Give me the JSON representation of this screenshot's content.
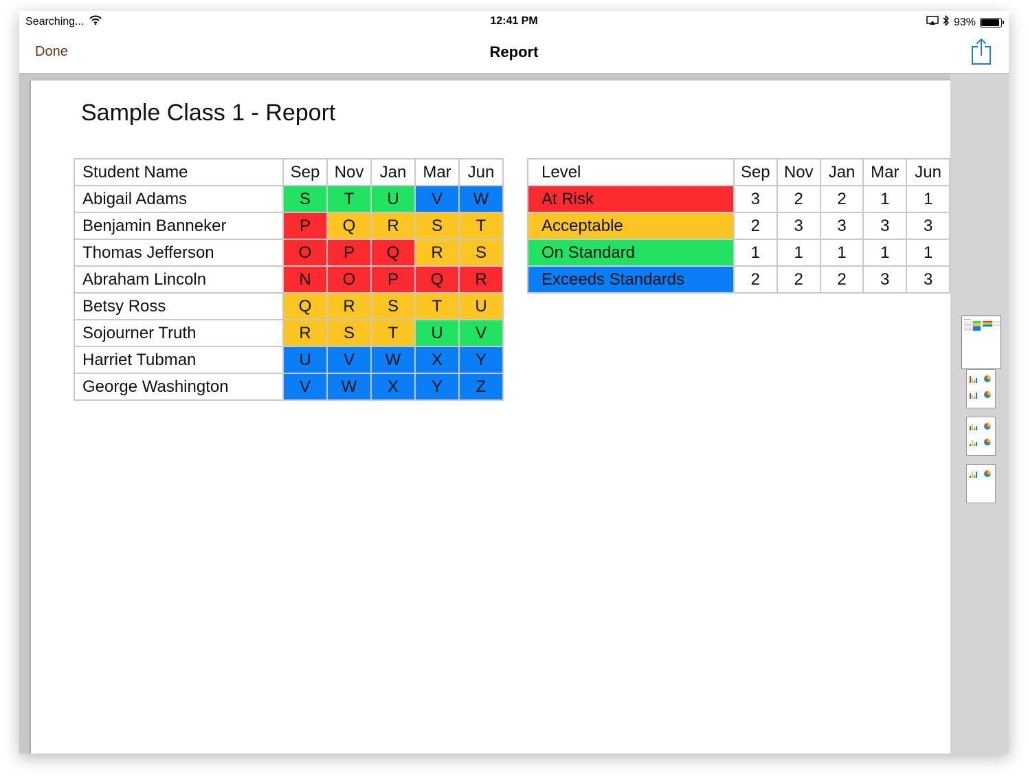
{
  "status_bar": {
    "carrier": "Searching...",
    "time": "12:41 PM",
    "battery": "93%",
    "battery_level": 0.93
  },
  "nav": {
    "done_label": "Done",
    "title": "Report"
  },
  "report": {
    "title": "Sample Class 1 - Report",
    "months": [
      "Sep",
      "Nov",
      "Jan",
      "Mar",
      "Jun"
    ],
    "students_header": "Student Name",
    "students": [
      {
        "name": "Abigail Adams",
        "grades": [
          "S",
          "T",
          "U",
          "V",
          "W"
        ],
        "colors": [
          "#22e261",
          "#22e261",
          "#22e261",
          "#0a7ef7",
          "#0a7ef7"
        ]
      },
      {
        "name": "Benjamin Banneker",
        "grades": [
          "P",
          "Q",
          "R",
          "S",
          "T"
        ],
        "colors": [
          "#fd2a2f",
          "#fdc521",
          "#fdc521",
          "#fdc521",
          "#fdc521"
        ]
      },
      {
        "name": "Thomas Jefferson",
        "grades": [
          "O",
          "P",
          "Q",
          "R",
          "S"
        ],
        "colors": [
          "#fd2a2f",
          "#fd2a2f",
          "#fd2a2f",
          "#fdc521",
          "#fdc521"
        ]
      },
      {
        "name": "Abraham Lincoln",
        "grades": [
          "N",
          "O",
          "P",
          "Q",
          "R"
        ],
        "colors": [
          "#fd2a2f",
          "#fd2a2f",
          "#fd2a2f",
          "#fd2a2f",
          "#fd2a2f"
        ]
      },
      {
        "name": "Betsy Ross",
        "grades": [
          "Q",
          "R",
          "S",
          "T",
          "U"
        ],
        "colors": [
          "#fdc521",
          "#fdc521",
          "#fdc521",
          "#fdc521",
          "#fdc521"
        ]
      },
      {
        "name": "Sojourner Truth",
        "grades": [
          "R",
          "S",
          "T",
          "U",
          "V"
        ],
        "colors": [
          "#fdc521",
          "#fdc521",
          "#fdc521",
          "#22e261",
          "#22e261"
        ]
      },
      {
        "name": "Harriet Tubman",
        "grades": [
          "U",
          "V",
          "W",
          "X",
          "Y"
        ],
        "colors": [
          "#0a7ef7",
          "#0a7ef7",
          "#0a7ef7",
          "#0a7ef7",
          "#0a7ef7"
        ]
      },
      {
        "name": "George Washington",
        "grades": [
          "V",
          "W",
          "X",
          "Y",
          "Z"
        ],
        "colors": [
          "#0a7ef7",
          "#0a7ef7",
          "#0a7ef7",
          "#0a7ef7",
          "#0a7ef7"
        ]
      }
    ],
    "levels_header": "Level",
    "levels": [
      {
        "name": "At Risk",
        "color": "#fd2a2f",
        "counts": [
          "3",
          "2",
          "2",
          "1",
          "1"
        ]
      },
      {
        "name": "Acceptable",
        "color": "#fdc521",
        "counts": [
          "2",
          "3",
          "3",
          "3",
          "3"
        ]
      },
      {
        "name": "On Standard",
        "color": "#22e261",
        "counts": [
          "1",
          "1",
          "1",
          "1",
          "1"
        ]
      },
      {
        "name": "Exceeds Standards",
        "color": "#0a7ef7",
        "counts": [
          "2",
          "2",
          "2",
          "3",
          "3"
        ]
      }
    ]
  },
  "thumbnails": {
    "count": 4,
    "selected_index": 0
  },
  "colors": {
    "accent": "#1f7ae0",
    "done_text": "#5b3a0a",
    "at_risk": "#fd2a2f",
    "acceptable": "#fdc521",
    "on_standard": "#22e261",
    "exceeds": "#0a7ef7"
  }
}
